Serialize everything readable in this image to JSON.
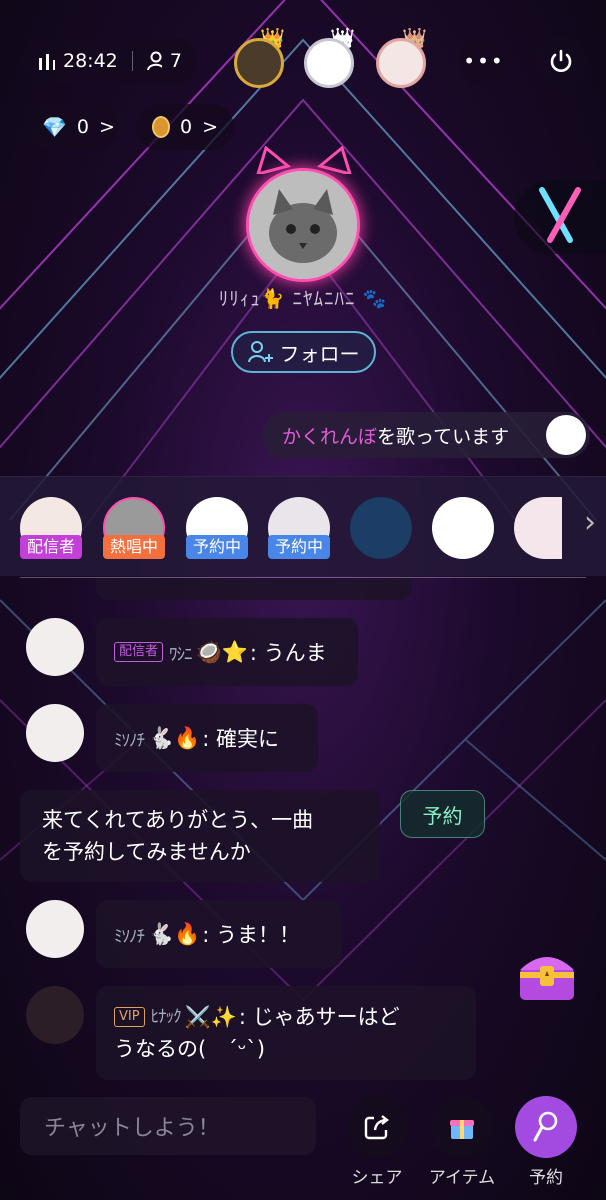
{
  "top_bar": {
    "timer": "28:42",
    "listeners": "7",
    "more_label": "•••"
  },
  "currency": {
    "diamonds": "0",
    "coins": "0",
    "arrow": ">"
  },
  "host": {
    "name": "ﾘﾘｨｭ🐈 ﾆﾔﾑﾆﾊﾆ 🐾",
    "follow_label": "フォロー"
  },
  "now_singing": {
    "song": "かくれんぼ",
    "suffix": " を歌っています"
  },
  "queue": {
    "items": [
      {
        "tag": "配信者",
        "tag_color": "#c23fd8"
      },
      {
        "tag": "熱唱中",
        "tag_color": "#f2703e"
      },
      {
        "tag": "予約中",
        "tag_color": "#4a86e8"
      },
      {
        "tag": "予約中",
        "tag_color": "#4a86e8"
      }
    ],
    "next_arrow": "›"
  },
  "messages": [
    {
      "badge": "配信者",
      "name": "ﾜｼﾆ",
      "emoji": "🥥⭐",
      "text": ": うんま"
    },
    {
      "name": "ﾐｿﾉﾁ",
      "emoji": "🐇🔥",
      "text": ": 確実に"
    },
    {
      "text_line1": "来てくれてありがとう、一曲",
      "text_line2": "を予約してみませんか",
      "action": "予約"
    },
    {
      "name": "ﾐｿﾉﾁ",
      "emoji": "🐇🔥",
      "text": ": うま！！"
    },
    {
      "badge": "VIP",
      "name": "ﾋﾅｯｸ",
      "emoji": "⚔️✨",
      "text_line1": ": じゃあサーはど",
      "text_line2": "うなるの(　ˊᵕˋ)"
    }
  ],
  "bottom": {
    "chat_placeholder": "チャットしよう！",
    "share_label": "シェア",
    "item_label": "アイテム",
    "reserve_label": "予約"
  },
  "colors": {
    "accent_pink": "#e35bd7",
    "follow_border": "#5fb2d6",
    "reserve_green": "#8af0c8",
    "reserve_purple": "#a34be0"
  }
}
